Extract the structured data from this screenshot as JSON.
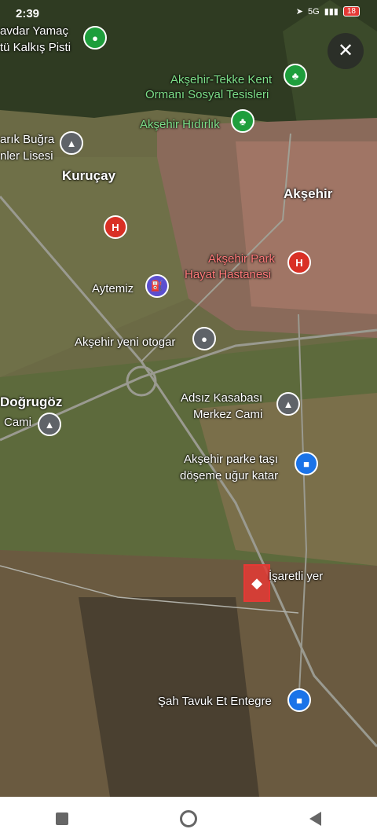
{
  "status_bar": {
    "time": "2:39",
    "network": "5G",
    "battery": "18"
  },
  "close_icon": "close-icon",
  "labels": {
    "yamac": "avdar Yamaç",
    "pisti": "tü Kalkış Pisti",
    "tekke": "Akşehir-Tekke Kent",
    "tekke2": "Ormanı Sosyal Tesisleri",
    "hidirlik": "Akşehir Hıdırlık",
    "bugra": "arık Buğra",
    "lisesi": "nler Lisesi",
    "kurucay": "Kuruçay",
    "aksehir": "Akşehir",
    "park": "Akşehir Park",
    "hastane": "Hayat Hastanesi",
    "aytemiz": "Aytemiz",
    "otogar": "Akşehir yeni otogar",
    "adsiz": "Adsız Kasabası",
    "merkez": "Merkez Cami",
    "dogrugoz": "Doğrugöz",
    "cami": "Cami",
    "parke": "Akşehir parke taşı",
    "doseme": "döşeme uğur katar",
    "isaretli": "İşaretli yer",
    "sah": "Şah Tavuk Et Entegre"
  },
  "pin_letters": {
    "hospital": "H"
  },
  "colors": {
    "hospital": "#d93025",
    "park": "#1e9e3c",
    "shop": "#1a73e8"
  }
}
